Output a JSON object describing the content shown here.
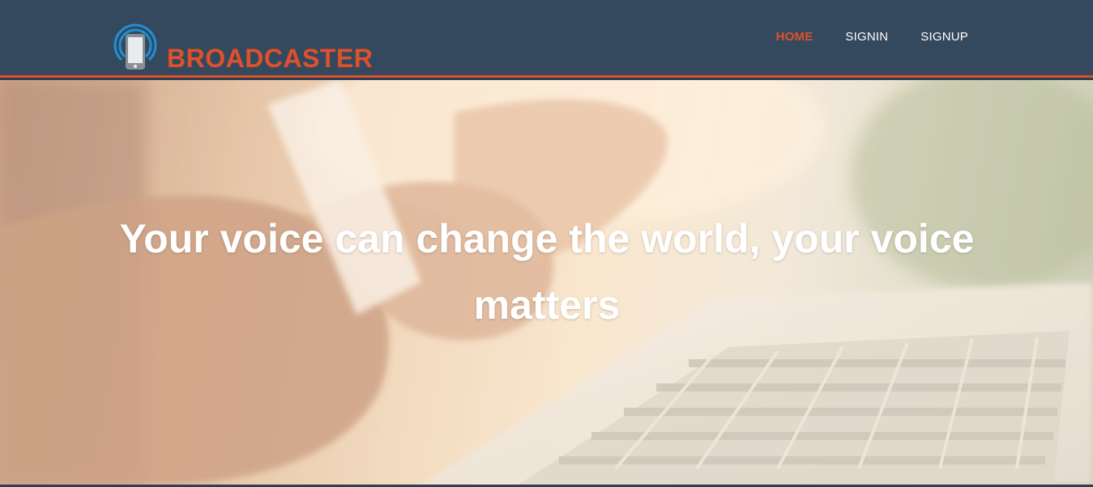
{
  "brand": {
    "name": "BROADCASTER",
    "logo_icon": "broadcast-phone-icon",
    "color": "#e0502a"
  },
  "nav": {
    "items": [
      {
        "label": "HOME",
        "active": true
      },
      {
        "label": "SIGNIN",
        "active": false
      },
      {
        "label": "SIGNUP",
        "active": false
      }
    ]
  },
  "hero": {
    "title": "Your voice can change the world, your voice matters",
    "background": "hands-typing-laptop-photo"
  },
  "colors": {
    "navbar": "#34495e",
    "accent": "#e0502a",
    "text": "#ffffff"
  }
}
